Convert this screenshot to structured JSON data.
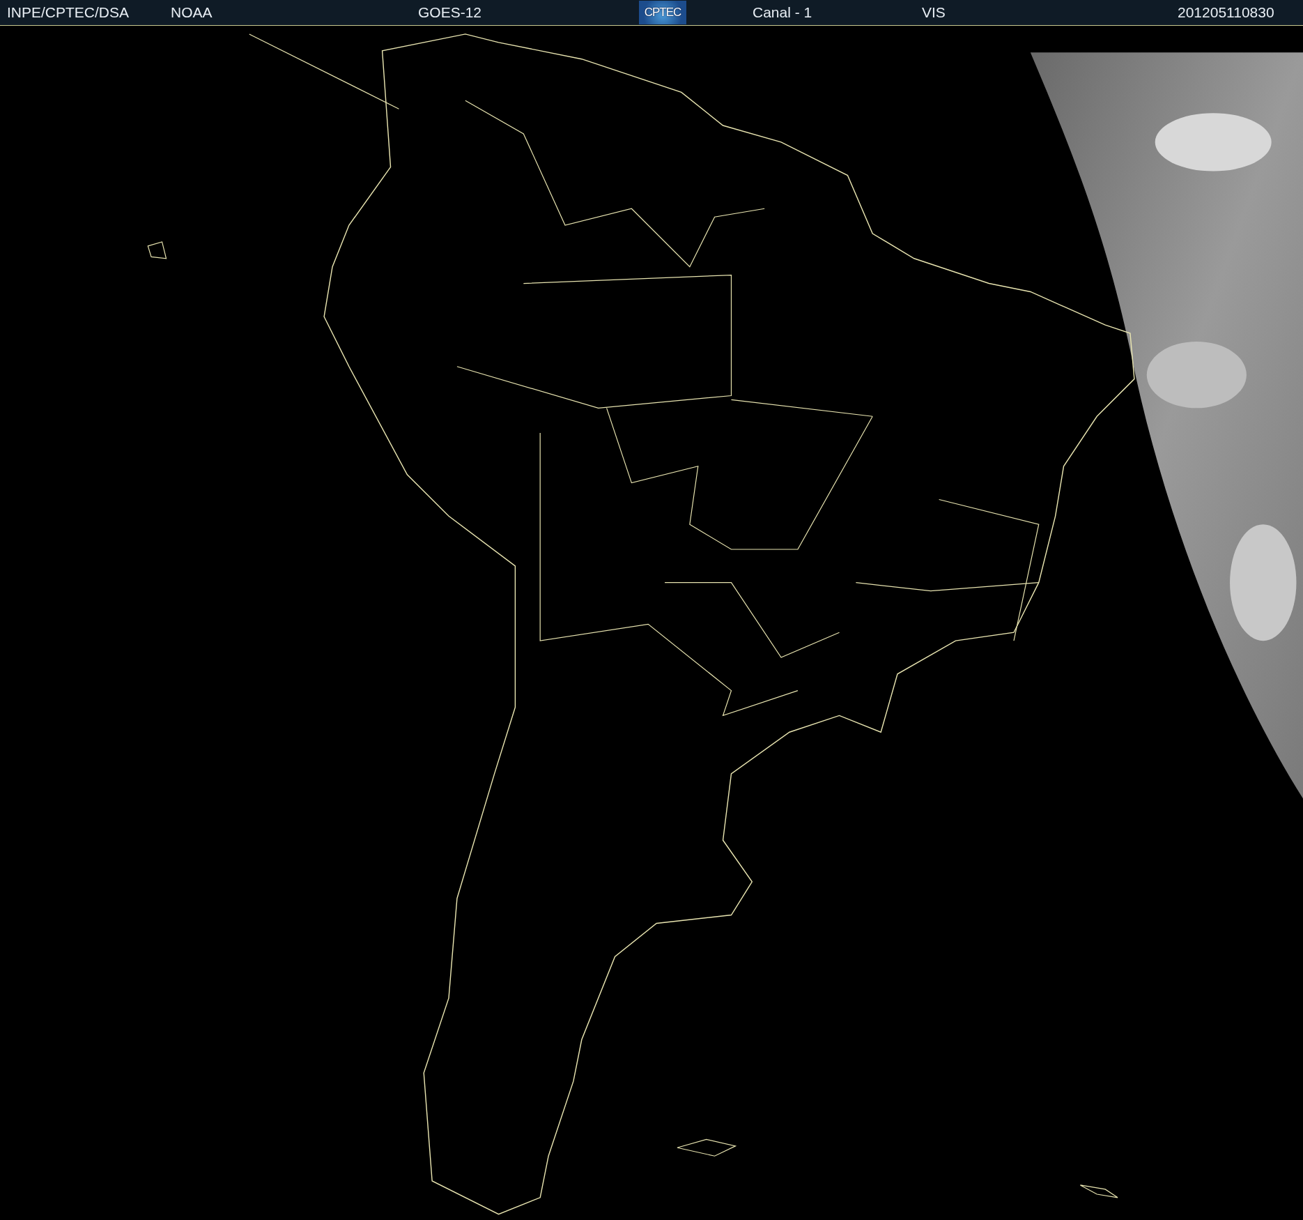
{
  "header": {
    "source": "INPE/CPTEC/DSA",
    "agency": "NOAA",
    "satellite": "GOES-12",
    "logo": "CPTEC",
    "channel": "Canal - 1",
    "band": "VIS",
    "timestamp": "201205110830"
  }
}
